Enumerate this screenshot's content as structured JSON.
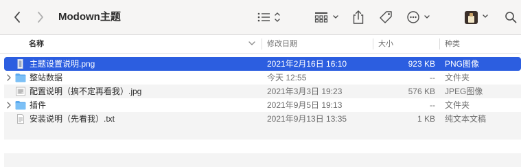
{
  "window": {
    "title": "Modown主题"
  },
  "toolbar": {
    "back_icon": "chevron-left-icon",
    "forward_icon": "chevron-right-icon",
    "list_view_icon": "list-view-icon",
    "group_icon": "group-grid-icon",
    "share_icon": "share-icon",
    "tag_icon": "tag-icon",
    "more_icon": "ellipsis-circle-icon",
    "search_icon": "search-icon"
  },
  "columns": {
    "name": "名称",
    "date": "修改日期",
    "size": "大小",
    "kind": "种类"
  },
  "files": [
    {
      "name": "主题设置说明.png",
      "date": "2021年2月16日 16:10",
      "size": "923 KB",
      "kind": "PNG图像",
      "type": "image",
      "expandable": false,
      "selected": true
    },
    {
      "name": "整站数据",
      "date": "今天 12:55",
      "size": "--",
      "kind": "文件夹",
      "type": "folder",
      "expandable": true,
      "selected": false
    },
    {
      "name": "配置说明（搞不定再看我）.jpg",
      "date": "2021年3月3日 19:23",
      "size": "576 KB",
      "kind": "JPEG图像",
      "type": "image",
      "expandable": false,
      "selected": false
    },
    {
      "name": "插件",
      "date": "2021年9月5日 19:13",
      "size": "--",
      "kind": "文件夹",
      "type": "folder",
      "expandable": true,
      "selected": false
    },
    {
      "name": "安装说明（先看我）.txt",
      "date": "2021年9月13日 13:35",
      "size": "1 KB",
      "kind": "纯文本文稿",
      "type": "text",
      "expandable": false,
      "selected": false
    }
  ],
  "colors": {
    "selection": "#2c5ee0",
    "folder": "#5aa9ee",
    "stripe": "#f4f4f4"
  }
}
